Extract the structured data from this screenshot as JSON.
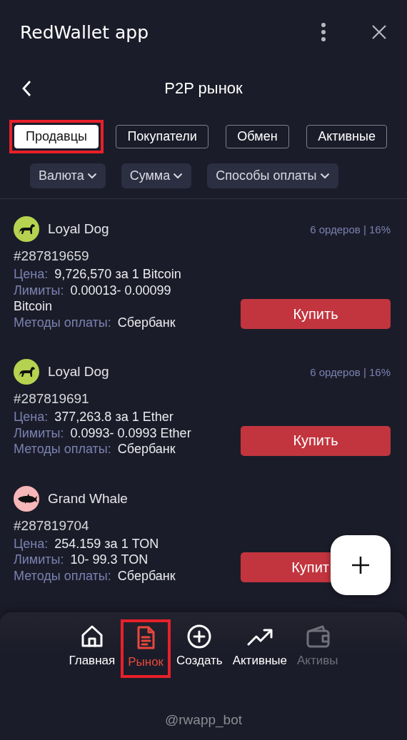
{
  "app": {
    "title": "RedWallet app"
  },
  "page": {
    "title": "P2P рынок"
  },
  "tabs": [
    {
      "label": "Продавцы",
      "selected": true,
      "highlighted": true
    },
    {
      "label": "Покупатели",
      "selected": false,
      "highlighted": false
    },
    {
      "label": "Обмен",
      "selected": false,
      "highlighted": false
    },
    {
      "label": "Активные",
      "selected": false,
      "highlighted": false
    }
  ],
  "filters": [
    {
      "label": "Валюта"
    },
    {
      "label": "Сумма"
    },
    {
      "label": "Способы оплаты"
    }
  ],
  "offers": [
    {
      "avatar": {
        "kind": "dog",
        "color": "#b5d350"
      },
      "name": "Loyal Dog",
      "stats": "6 ордеров | 16%",
      "id": "#287819659",
      "price_label": "Цена:",
      "price": "9,726,570 за 1 Bitcoin",
      "limits_label": "Лимиты:",
      "limits": "0.00013- 0.00099 Bitcoin",
      "methods_label": "Методы оплаты:",
      "methods": "Сбербанк",
      "button": "Купить"
    },
    {
      "avatar": {
        "kind": "dog",
        "color": "#b5d350"
      },
      "name": "Loyal Dog",
      "stats": "6 ордеров | 16%",
      "id": "#287819691",
      "price_label": "Цена:",
      "price": "377,263.8 за 1 Ether",
      "limits_label": "Лимиты:",
      "limits": "0.0993- 0.0993 Ether",
      "methods_label": "Методы оплаты:",
      "methods": "Сбербанк",
      "button": "Купить"
    },
    {
      "avatar": {
        "kind": "fish",
        "color": "#f7b6b8"
      },
      "name": "Grand Whale",
      "id": "#287819704",
      "price_label": "Цена:",
      "price": "254.159 за 1 TON",
      "limits_label": "Лимиты:",
      "limits": "10- 99.3 TON",
      "methods_label": "Методы оплаты:",
      "methods": "Сбербанк",
      "button": "Купит",
      "button_covered": true
    }
  ],
  "nav": [
    {
      "label": "Главная",
      "kind": "home",
      "selected": false,
      "disabled": false,
      "highlighted": false
    },
    {
      "label": "Рынок",
      "kind": "document",
      "selected": true,
      "disabled": false,
      "highlighted": true
    },
    {
      "label": "Создать",
      "kind": "create",
      "selected": false,
      "disabled": false,
      "highlighted": false
    },
    {
      "label": "Активные",
      "kind": "trend",
      "selected": false,
      "disabled": false,
      "highlighted": false
    },
    {
      "label": "Активы",
      "kind": "wallet",
      "selected": false,
      "disabled": true,
      "highlighted": false
    }
  ],
  "footer": "@rwapp_bot"
}
